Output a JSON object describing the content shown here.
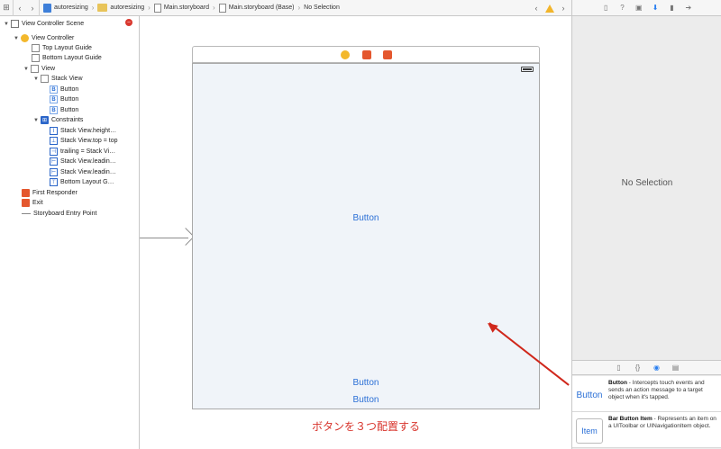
{
  "jumpbar": {
    "crumbs": [
      "autoresizing",
      "autoresizing",
      "Main.storyboard",
      "Main.storyboard (Base)",
      "No Selection"
    ]
  },
  "outline": {
    "items": [
      {
        "label": "View Controller Scene",
        "icon": "scene-icon"
      },
      {
        "label": "View Controller",
        "icon": "view-controller-icon"
      },
      {
        "label": "Top Layout Guide",
        "icon": "layout-guide-icon"
      },
      {
        "label": "Bottom Layout Guide",
        "icon": "layout-guide-icon"
      },
      {
        "label": "View",
        "icon": "view-icon"
      },
      {
        "label": "Stack View",
        "icon": "stack-view-icon"
      },
      {
        "label": "Button",
        "icon": "button-icon"
      },
      {
        "label": "Button",
        "icon": "button-icon"
      },
      {
        "label": "Button",
        "icon": "button-icon"
      },
      {
        "label": "Constraints",
        "icon": "constraints-icon"
      },
      {
        "label": "Stack View.height…",
        "icon": "constraint-icon"
      },
      {
        "label": "Stack View.top = top",
        "icon": "constraint-icon"
      },
      {
        "label": "trailing = Stack Vi…",
        "icon": "constraint-icon"
      },
      {
        "label": "Stack View.leadin…",
        "icon": "constraint-icon"
      },
      {
        "label": "Stack View.leadin…",
        "icon": "constraint-icon"
      },
      {
        "label": "Bottom Layout G…",
        "icon": "constraint-icon"
      },
      {
        "label": "First Responder",
        "icon": "first-responder-icon"
      },
      {
        "label": "Exit",
        "icon": "exit-icon"
      },
      {
        "label": "Storyboard Entry Point",
        "icon": "entry-point-icon"
      }
    ]
  },
  "canvas": {
    "button_labels": [
      "Button",
      "Button",
      "Button"
    ],
    "caption": "ボタンを３つ配置する"
  },
  "inspector": {
    "empty_text": "No Selection"
  },
  "library": {
    "items": [
      {
        "icon_label": "Button",
        "title": "Button",
        "description": " - Intercepts touch events and sends an action message to a target object when it's tapped."
      },
      {
        "icon_label": "Item",
        "title": "Bar Button Item",
        "description": " - Represents an item on a UIToolbar or UINavigationItem object."
      }
    ]
  },
  "colors": {
    "accent": "#2a7ff0",
    "annotation": "#d0271b",
    "button_text": "#2a6fd6"
  }
}
